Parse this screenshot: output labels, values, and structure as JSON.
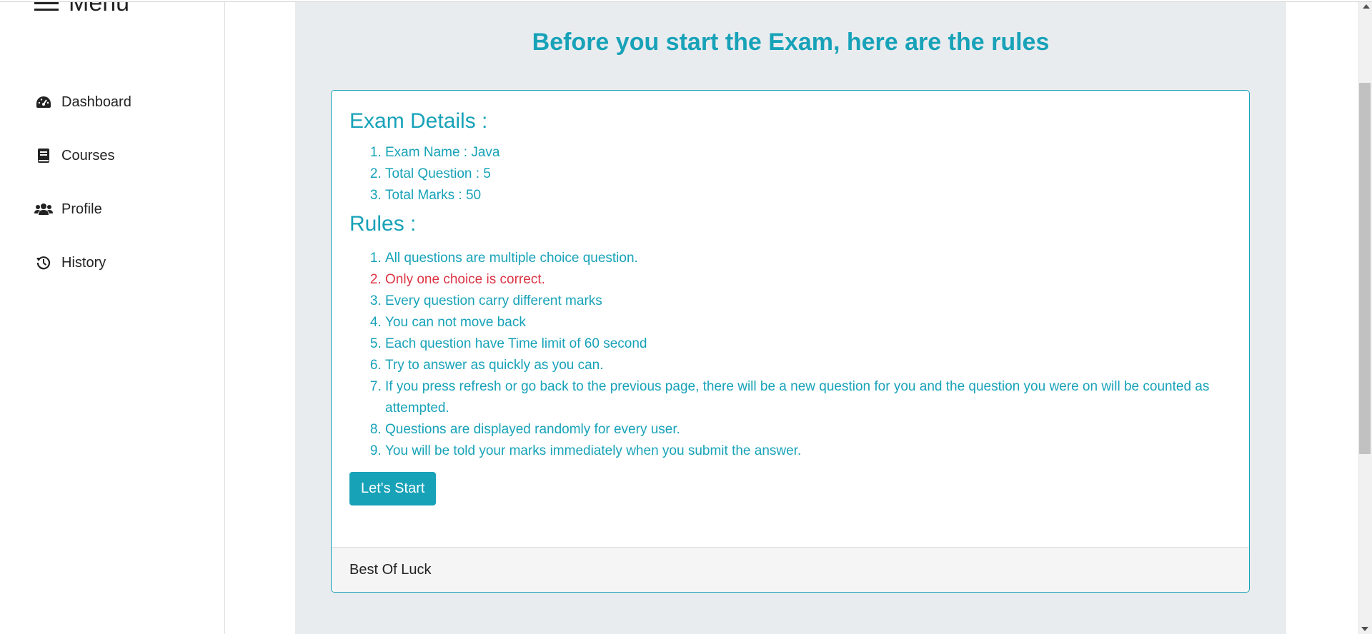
{
  "sidebar": {
    "menu_label": "Menu",
    "items": [
      {
        "label": "Dashboard",
        "icon": "dashboard-icon"
      },
      {
        "label": "Courses",
        "icon": "book-icon"
      },
      {
        "label": "Profile",
        "icon": "users-icon"
      },
      {
        "label": "History",
        "icon": "history-icon"
      }
    ]
  },
  "main": {
    "title": "Before you start the Exam, here are the rules",
    "exam_details_heading": "Exam Details :",
    "exam_details": [
      "Exam Name : Java",
      "Total Question : 5",
      "Total Marks : 50"
    ],
    "rules_heading": "Rules :",
    "rules": [
      "All questions are multiple choice question.",
      "Only one choice is correct.",
      "Every question carry different marks",
      "You can not move back",
      "Each question have Time limit of 60 second",
      "Try to answer as quickly as you can.",
      "If you press refresh or go back to the previous page, there will be a new question for you and the question you were on will be counted as attempted.",
      "Questions are displayed randomly for every user.",
      "You will be told your marks immediately when you submit the answer."
    ],
    "start_button": "Let's Start",
    "footer": "Best Of Luck"
  },
  "colors": {
    "accent": "#17a2b8",
    "danger": "#dc3545",
    "panel_bg": "#e9ecef"
  }
}
